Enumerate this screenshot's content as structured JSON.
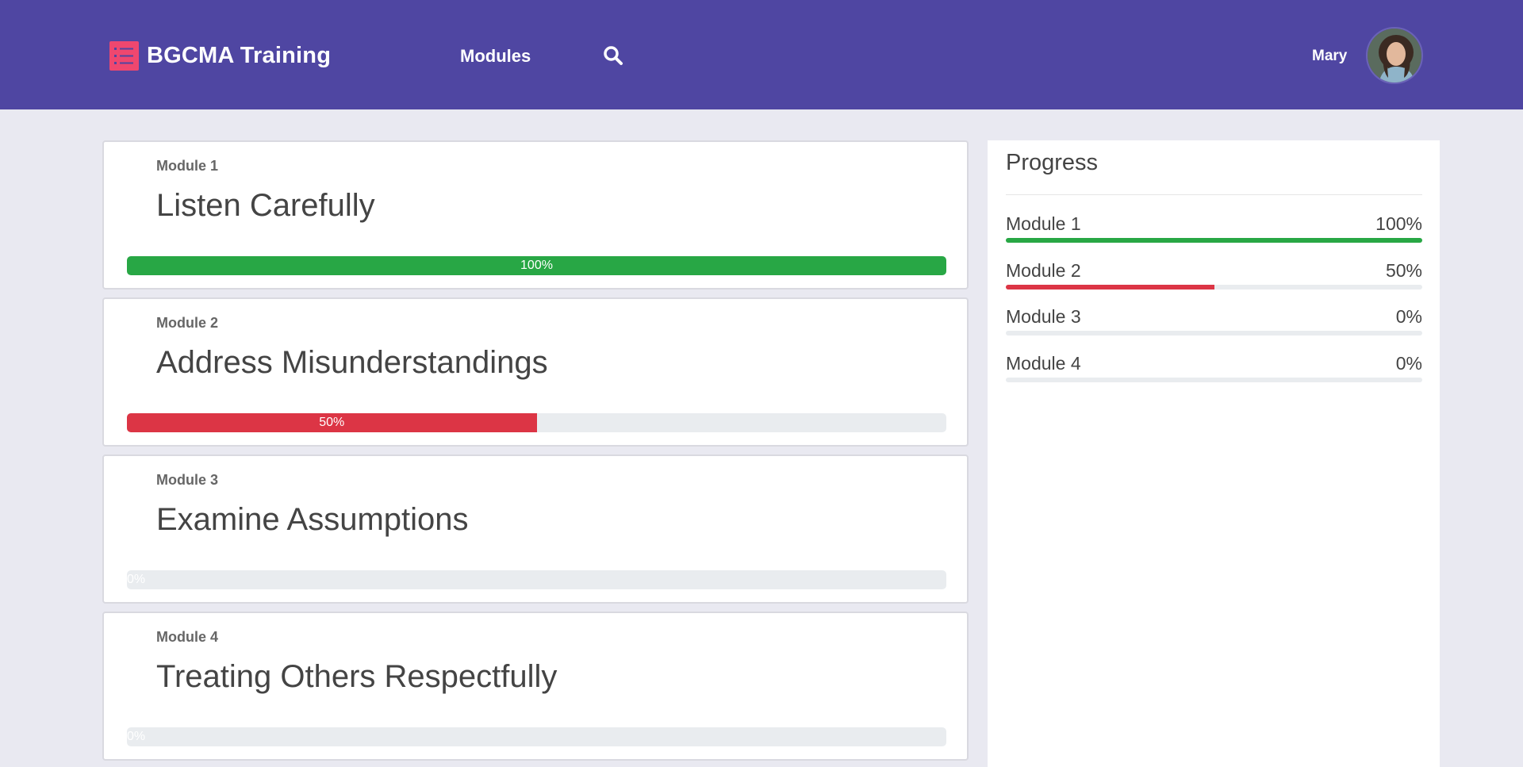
{
  "header": {
    "brand": "BGCMA Training",
    "nav_modules": "Modules",
    "user_name": "Mary"
  },
  "colors": {
    "header_bg": "#4f46a2",
    "brand_icon": "#ef476f",
    "success": "#28a745",
    "danger": "#dc3545",
    "track": "#e9ecef"
  },
  "modules": [
    {
      "kicker": "Module 1",
      "title": "Listen Carefully",
      "progress_label": "100%",
      "progress": 100,
      "color": "#28a745"
    },
    {
      "kicker": "Module 2",
      "title": "Address Misunderstandings",
      "progress_label": "50%",
      "progress": 50,
      "color": "#dc3545"
    },
    {
      "kicker": "Module 3",
      "title": "Examine Assumptions",
      "progress_label": "0%",
      "progress": 0,
      "color": "#28a745"
    },
    {
      "kicker": "Module 4",
      "title": "Treating Others Respectfully",
      "progress_label": "0%",
      "progress": 0,
      "color": "#28a745"
    }
  ],
  "progress_panel": {
    "title": "Progress",
    "rows": [
      {
        "label": "Module 1",
        "value": "100%",
        "progress": 100,
        "color": "#28a745"
      },
      {
        "label": "Module 2",
        "value": "50%",
        "progress": 50,
        "color": "#dc3545"
      },
      {
        "label": "Module 3",
        "value": "0%",
        "progress": 0,
        "color": "#28a745"
      },
      {
        "label": "Module 4",
        "value": "0%",
        "progress": 0,
        "color": "#28a745"
      }
    ]
  }
}
